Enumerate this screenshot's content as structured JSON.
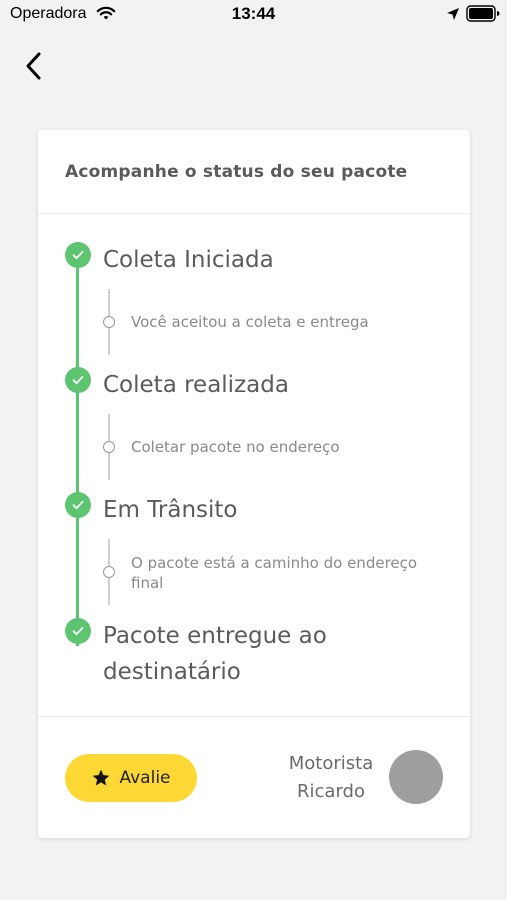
{
  "status_bar": {
    "carrier": "Operadora",
    "time": "13:44"
  },
  "card": {
    "title": "Acompanhe o status do seu pacote",
    "steps": [
      {
        "title": "Coleta Iniciada",
        "detail": "Você aceitou a coleta e entrega",
        "completed": true
      },
      {
        "title": "Coleta realizada",
        "detail": "Coletar pacote no endereço",
        "completed": true
      },
      {
        "title": "Em Trânsito",
        "detail": "O pacote está a caminho do endereço final",
        "completed": true
      },
      {
        "title": "Pacote entregue ao destinatário",
        "completed": true
      }
    ],
    "footer": {
      "rate_label": "Avalie",
      "driver_role": "Motorista",
      "driver_name": "Ricardo"
    }
  },
  "colors": {
    "accent_green": "#5dc46f",
    "button_yellow": "#fdd835",
    "avatar_gray": "#9e9e9e"
  }
}
